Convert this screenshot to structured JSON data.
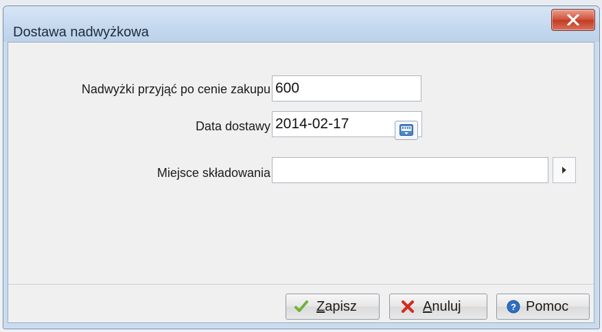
{
  "window": {
    "title": "Dostawa nadwyżkowa"
  },
  "form": {
    "price_label": "Nadwyżki przyjąć po cenie zakupu",
    "price_value": "600",
    "date_label": "Data dostawy",
    "date_value": "2014-02-17",
    "storage_label": "Miejsce składowania",
    "storage_value": ""
  },
  "buttons": {
    "save": {
      "accel": "Z",
      "rest": "apisz"
    },
    "cancel": {
      "accel": "A",
      "rest": "nuluj"
    },
    "help": {
      "label": "Pomoc"
    }
  },
  "icons": {
    "close": "close-icon",
    "calendar": "calendar-icon",
    "arrow": "triangle-right-icon",
    "check": "check-icon",
    "cancel": "cross-icon",
    "help": "help-icon"
  },
  "colors": {
    "close_button": "#c8432b",
    "check_icon": "#6fb23a",
    "cancel_icon": "#d22b1f",
    "help_icon": "#2f6fc2"
  }
}
